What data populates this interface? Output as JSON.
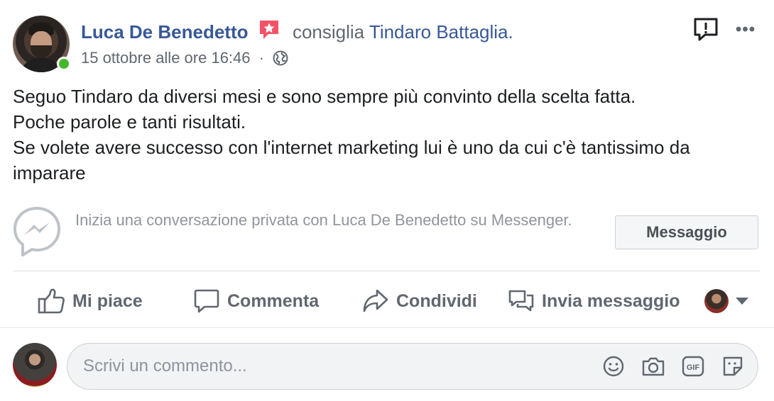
{
  "header": {
    "author": "Luca De Benedetto",
    "verb": "consiglia",
    "target": "Tindaro Battaglia.",
    "timestamp": "15 ottobre alle ore 16:46",
    "separator": "·",
    "more_label": "•••",
    "icons": {
      "report": "report-icon",
      "more": "more-icon",
      "audience": "globe-icon",
      "recommendation": "star-badge-icon"
    },
    "online_status_color": "#42b72a"
  },
  "post": {
    "lines": [
      "Seguo Tindaro da diversi mesi e sono sempre più convinto della scelta fatta.",
      "Poche parole e tanti risultati.",
      "Se volete avere successo con l'internet marketing lui è uno da cui c'è tantissimo da imparare"
    ]
  },
  "messenger": {
    "prompt": "Inizia una conversazione privata con Luca De Benedetto su Messenger.",
    "button_label": "Messaggio",
    "icon": "messenger-icon"
  },
  "actions": {
    "like": "Mi piace",
    "comment": "Commenta",
    "share": "Condividi",
    "send": "Invia messaggio"
  },
  "composer": {
    "placeholder": "Scrivi un commento...",
    "icons": [
      "emoji-icon",
      "camera-icon",
      "gif-icon",
      "sticker-icon"
    ]
  },
  "colors": {
    "link": "#385898",
    "muted": "#606770",
    "badge": "#f35369"
  }
}
